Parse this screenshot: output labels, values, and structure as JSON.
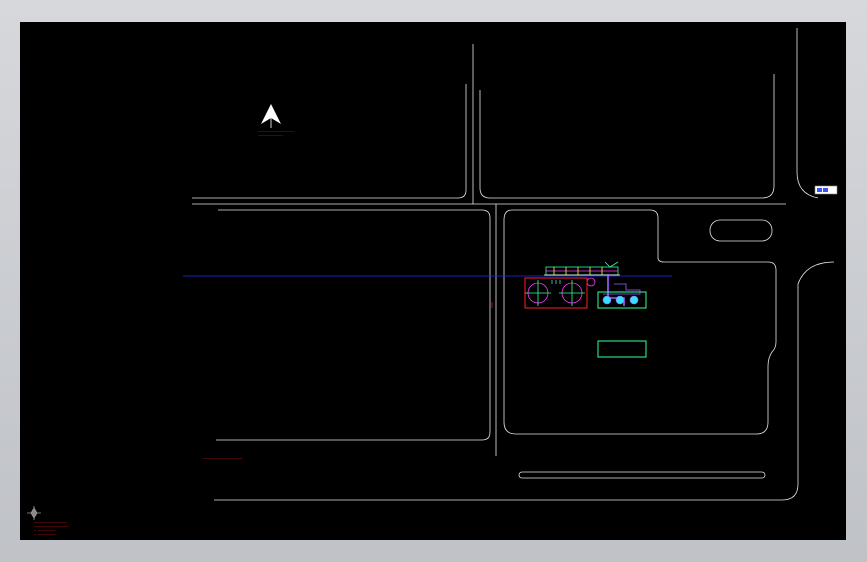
{
  "colors": {
    "background": "#000000",
    "frame": "#c9cbd0",
    "outline": "#e6e6e6",
    "axis_line": "#1a2aff",
    "red": "#ff2020",
    "green": "#33ff99",
    "cyan": "#33e0ff",
    "magenta": "#ff33ff",
    "purple": "#a060ff",
    "yellow": "#ffff33"
  },
  "icons": {
    "north_arrow": "north-arrow-icon",
    "ucs": "ucs-compass-icon",
    "viewport_tag": "viewport-tag-icon"
  },
  "annotations": {
    "north_note": [
      "────────────────────",
      "──────────────"
    ],
    "mid_note": "──────────────────────",
    "bottom_notes": [
      "──────────────────",
      "───────────────────",
      "─ ──────────",
      "─ ──────────"
    ]
  }
}
